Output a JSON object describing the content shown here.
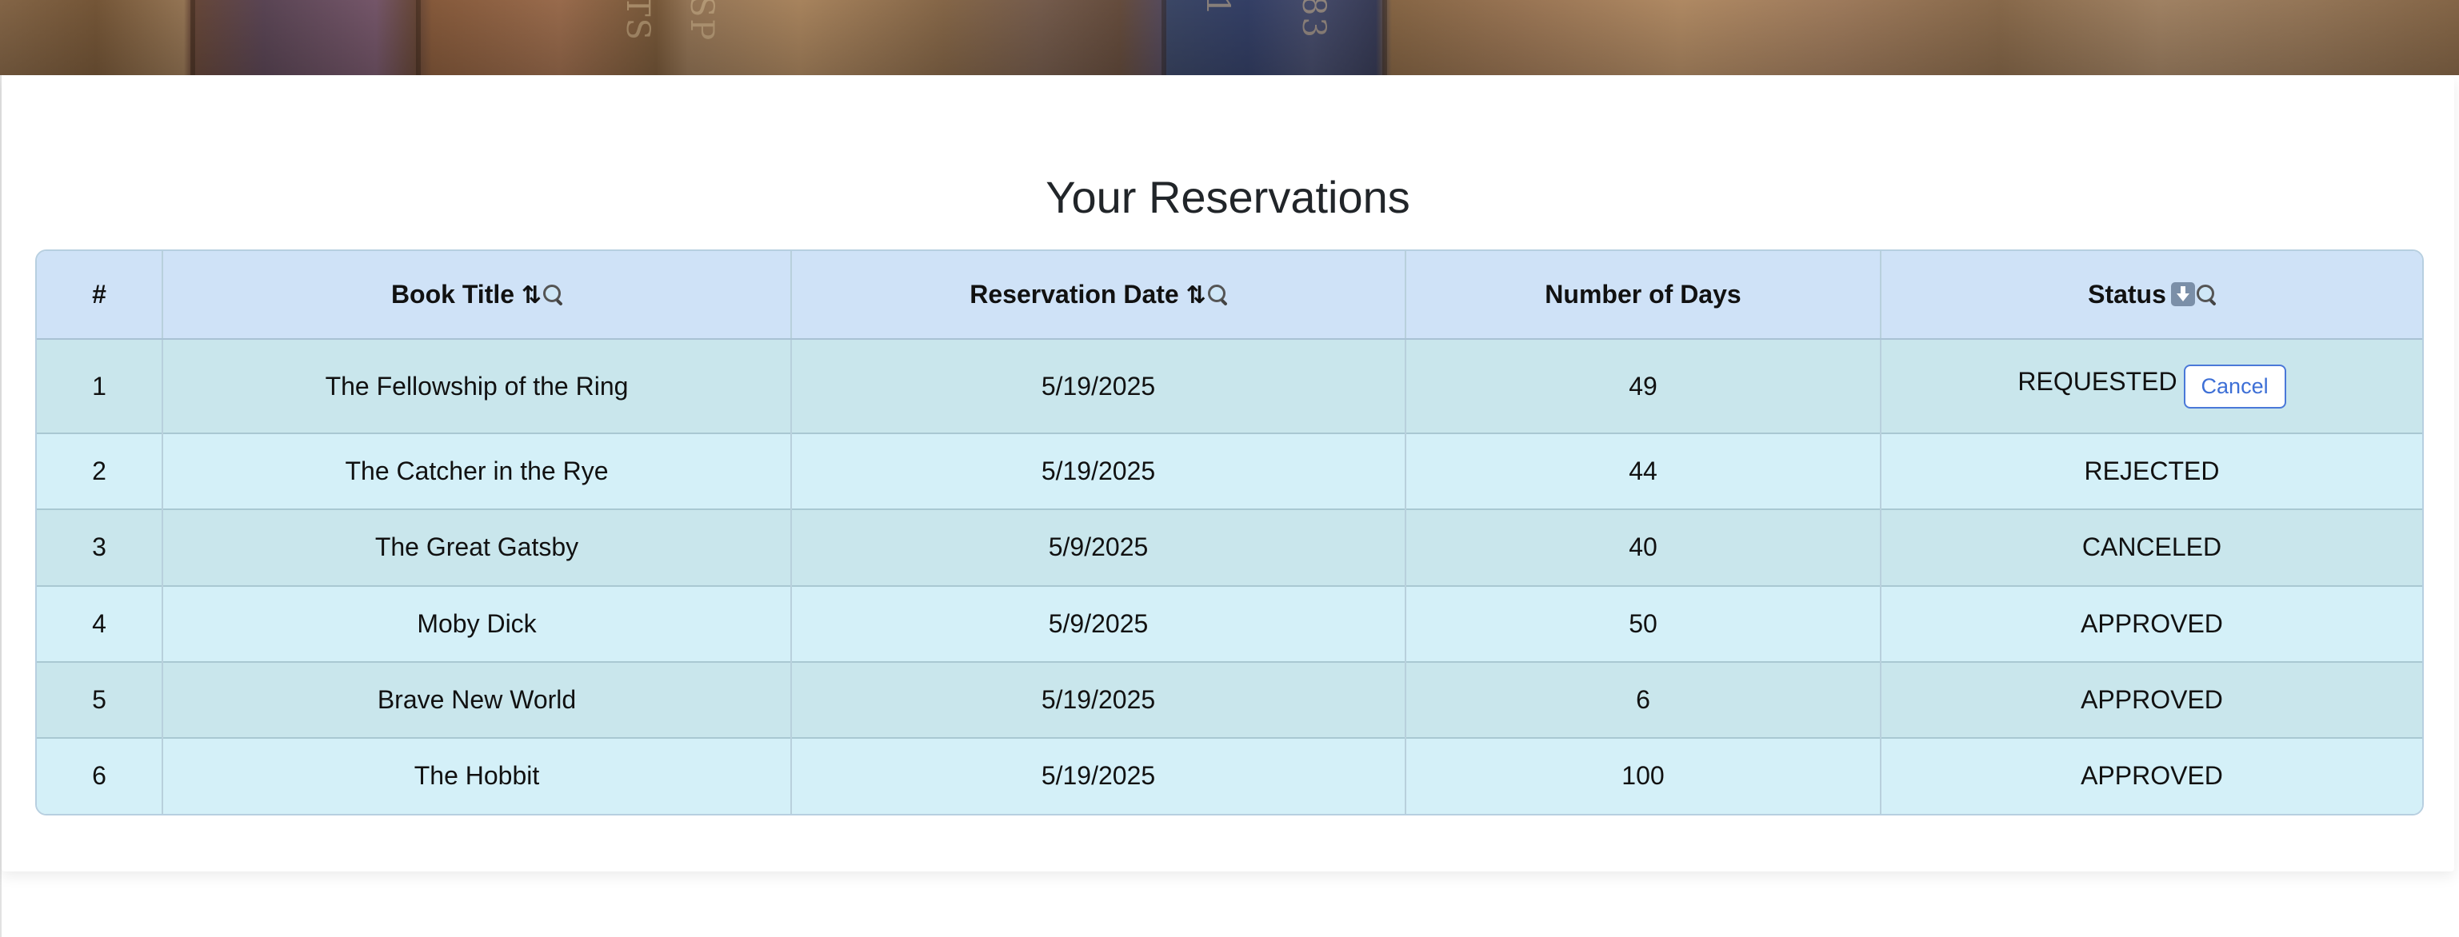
{
  "page": {
    "title": "Your Reservations"
  },
  "banner": {
    "spine_texts": [
      "TS",
      "SP",
      "1",
      "83"
    ]
  },
  "table": {
    "headers": {
      "index": "#",
      "book_title": "Book Title",
      "book_title_icons": "⇅",
      "reservation_date": "Reservation Date",
      "reservation_date_icons": "⇅",
      "number_of_days": "Number of Days",
      "status": "Status"
    },
    "rows": [
      {
        "index": "1",
        "title": "The Fellowship of the Ring",
        "date": "5/19/2025",
        "days": "49",
        "status": "REQUESTED",
        "action": "Cancel"
      },
      {
        "index": "2",
        "title": "The Catcher in the Rye",
        "date": "5/19/2025",
        "days": "44",
        "status": "REJECTED"
      },
      {
        "index": "3",
        "title": "The Great Gatsby",
        "date": "5/9/2025",
        "days": "40",
        "status": "CANCELED"
      },
      {
        "index": "4",
        "title": "Moby Dick",
        "date": "5/9/2025",
        "days": "50",
        "status": "APPROVED"
      },
      {
        "index": "5",
        "title": "Brave New World",
        "date": "5/19/2025",
        "days": "6",
        "status": "APPROVED"
      },
      {
        "index": "6",
        "title": "The Hobbit",
        "date": "5/19/2025",
        "days": "100",
        "status": "APPROVED"
      }
    ]
  },
  "colors": {
    "header_bg": "#cfe2f7",
    "row_odd_bg": "#c9e6ec",
    "row_even_bg": "#d4f0f8",
    "cancel_accent": "#3d6fd6"
  },
  "icons": {
    "sort": "sort-arrows-icon",
    "search": "magnifier-icon",
    "status_sort": "down-arrow-box-icon"
  }
}
